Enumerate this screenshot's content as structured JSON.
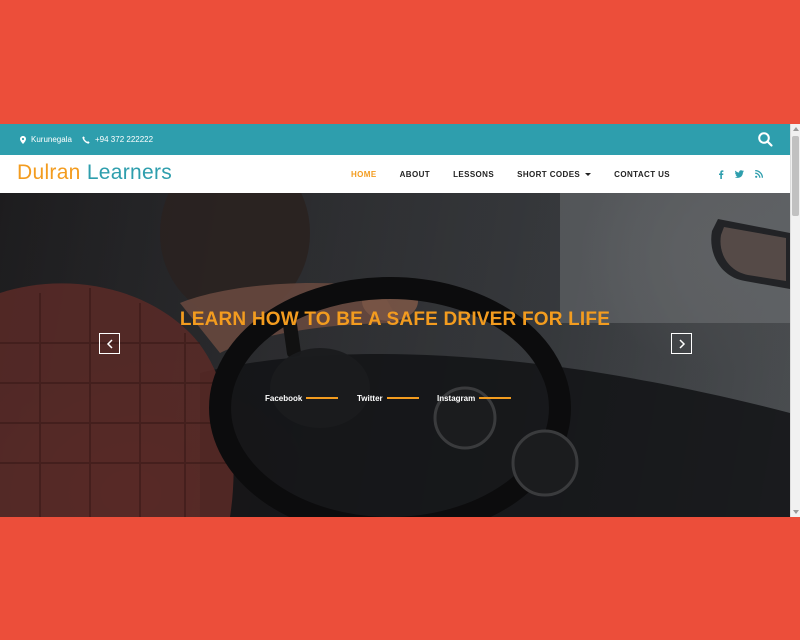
{
  "topbar": {
    "location": "Kurunegala",
    "phone": "+94 372 222222",
    "icons": {
      "location": "map-pin-icon",
      "phone": "phone-icon",
      "search": "search-icon"
    }
  },
  "brand": {
    "word1": "Dulran",
    "word2": "Learners"
  },
  "nav": {
    "items": [
      {
        "label": "HOME",
        "active": true
      },
      {
        "label": "ABOUT"
      },
      {
        "label": "LESSONS"
      },
      {
        "label": "SHORT CODES",
        "dropdown": true
      },
      {
        "label": "CONTACT US"
      }
    ],
    "social_icons": [
      "facebook-icon",
      "twitter-icon",
      "rss-icon"
    ]
  },
  "hero": {
    "title": "LEARN HOW TO BE A SAFE DRIVER FOR LIFE",
    "social_links": [
      {
        "label": "Facebook"
      },
      {
        "label": "Twitter"
      },
      {
        "label": "Instagram"
      }
    ]
  },
  "colors": {
    "background": "#ec4e3a",
    "topbar": "#2e9ead",
    "accent_orange": "#f39c1f",
    "accent_teal": "#2e9ead",
    "nav_text": "#222222"
  }
}
